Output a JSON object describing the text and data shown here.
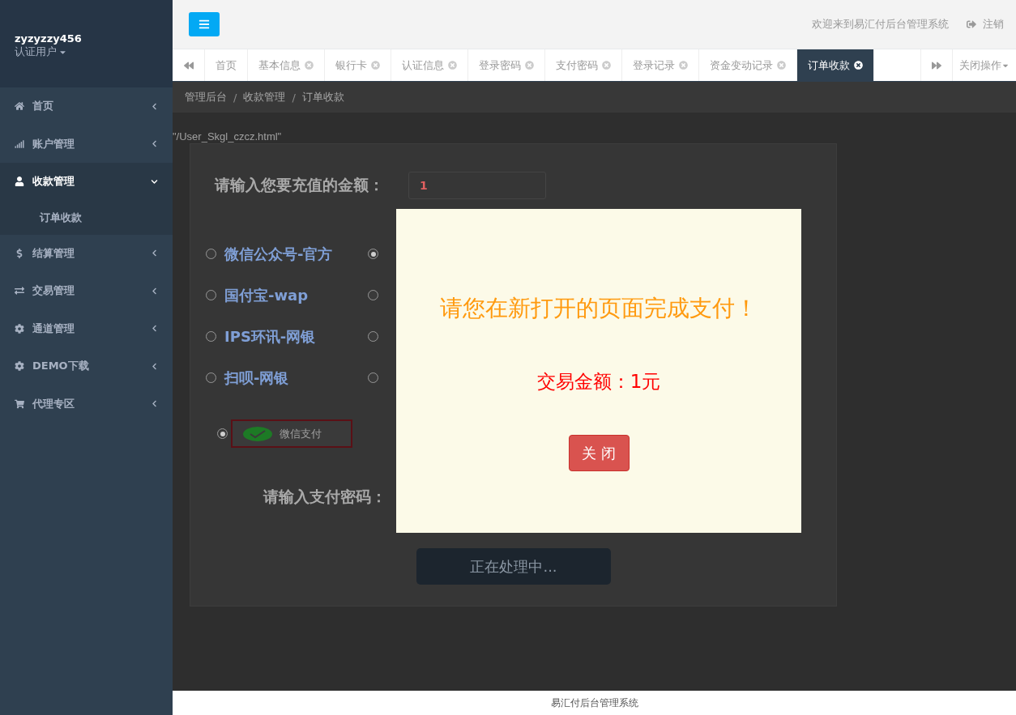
{
  "user": {
    "name": "zyzyzzy456",
    "role": "认证用户"
  },
  "sidebar": {
    "items": [
      {
        "label": "首页",
        "selected": false,
        "expanded": false
      },
      {
        "label": "账户管理",
        "selected": false,
        "expanded": false
      },
      {
        "label": "收款管理",
        "selected": true,
        "expanded": true,
        "children": [
          {
            "label": "订单收款"
          }
        ]
      },
      {
        "label": "结算管理",
        "selected": false,
        "expanded": false
      },
      {
        "label": "交易管理",
        "selected": false,
        "expanded": false
      },
      {
        "label": "通道管理",
        "selected": false,
        "expanded": false
      },
      {
        "label": "DEMO下载",
        "selected": false,
        "expanded": false
      },
      {
        "label": "代理专区",
        "selected": false,
        "expanded": false
      }
    ]
  },
  "header": {
    "welcome": "欢迎来到易汇付后台管理系统",
    "logout": "注销"
  },
  "tabs": [
    {
      "label": "首页",
      "closable": false,
      "selected": false
    },
    {
      "label": "基本信息",
      "closable": true,
      "selected": false
    },
    {
      "label": "银行卡",
      "closable": true,
      "selected": false
    },
    {
      "label": "认证信息",
      "closable": true,
      "selected": false
    },
    {
      "label": "登录密码",
      "closable": true,
      "selected": false
    },
    {
      "label": "支付密码",
      "closable": true,
      "selected": false
    },
    {
      "label": "登录记录",
      "closable": true,
      "selected": false
    },
    {
      "label": "资金变动记录",
      "closable": true,
      "selected": false
    },
    {
      "label": "订单收款",
      "closable": true,
      "selected": true
    }
  ],
  "tab_actions": "关闭操作",
  "breadcrumb": [
    {
      "kind": "link",
      "label": "管理后台"
    },
    {
      "kind": "separator",
      "label": "/"
    },
    {
      "kind": "link",
      "label": "收款管理"
    },
    {
      "kind": "separator",
      "label": "/"
    },
    {
      "kind": "link",
      "label": "订单收款"
    }
  ],
  "path_text": "\"/User_Skgl_czcz.html\"",
  "form": {
    "amount_label": "请输入您要充值的金额：",
    "amount_value": "1",
    "payment_options": [
      {
        "label": "微信公众号-官方",
        "selected": false
      },
      {
        "selected": true
      },
      {
        "label": "国付宝-wap",
        "selected": false
      },
      {
        "selected": false
      },
      {
        "label": "IPS环讯-网银",
        "selected": false
      },
      {
        "selected": false
      },
      {
        "label": "扫呗-网银",
        "selected": false
      },
      {
        "selected": false
      }
    ],
    "wechat_option": {
      "label": "微信支付",
      "selected": true
    },
    "password_label": "请输入支付密码：",
    "submit_button": {
      "label": "正在处理中...",
      "disabled": true
    }
  },
  "modal": {
    "message": "请您在新打开的页面完成支付！",
    "amount": "交易金额：1元",
    "close_button": "关 闭"
  },
  "footer": "易汇付后台管理系统"
}
